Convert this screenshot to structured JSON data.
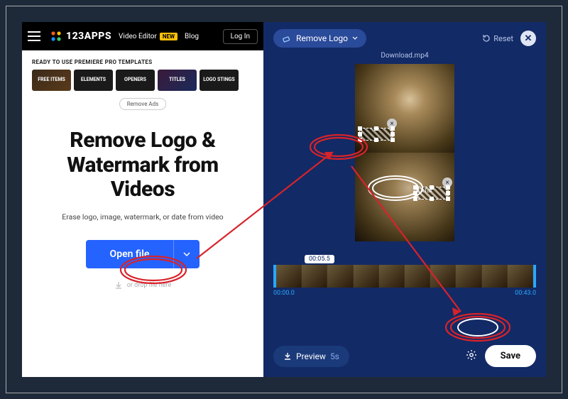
{
  "topbar": {
    "brand": "123APPS",
    "links": {
      "video_editor": "Video Editor",
      "video_editor_badge": "NEW",
      "blog": "Blog"
    },
    "login": "Log In"
  },
  "templates": {
    "heading": "READY TO USE PREMIERE PRO TEMPLATES",
    "items": [
      "FREE\nITEMS",
      "ELEMENTS",
      "OPENERS",
      "TITLES",
      "LOGO STINGS"
    ]
  },
  "remove_ads_label": "Remove Ads",
  "hero": {
    "title_l1": "Remove Logo &",
    "title_l2": "Watermark from",
    "title_l3": "Videos",
    "subtitle": "Erase logo, image, watermark, or date from video",
    "open_file": "Open file",
    "drop_hint": "or drop file here"
  },
  "editor": {
    "remove_logo_label": "Remove Logo",
    "reset_label": "Reset",
    "filename": "Download.mp4",
    "sel2_text": "TikTok",
    "clip_badge": "00:05.5",
    "time_start": "00:00.0",
    "time_end": "00:43.0",
    "preview_label": "Preview",
    "preview_seconds": "5s",
    "save_label": "Save"
  }
}
